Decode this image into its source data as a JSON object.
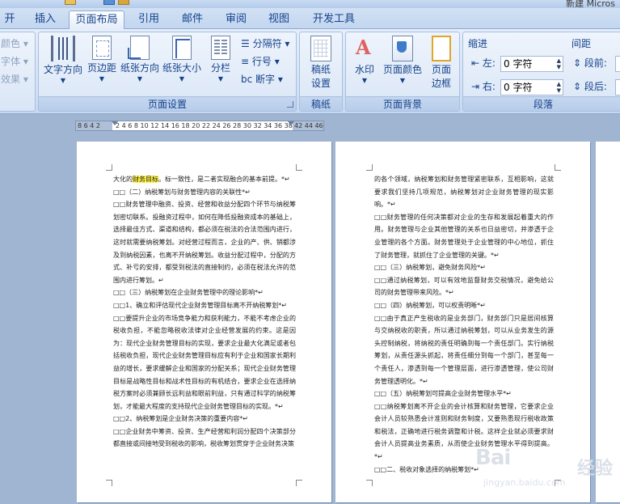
{
  "window": {
    "title_fragment": "新建 Micros"
  },
  "tabs": [
    {
      "label": "开始",
      "active": false
    },
    {
      "label": "插入",
      "active": false
    },
    {
      "label": "页面布局",
      "active": true
    },
    {
      "label": "引用",
      "active": false
    },
    {
      "label": "邮件",
      "active": false
    },
    {
      "label": "审阅",
      "active": false
    },
    {
      "label": "视图",
      "active": false
    },
    {
      "label": "开发工具",
      "active": false
    }
  ],
  "ribbon": {
    "themes": {
      "colors": "颜色",
      "fonts": "字体",
      "effects": "效果"
    },
    "page_setup": {
      "group_label": "页面设置",
      "text_direction": "文字方向",
      "margins": "页边距",
      "orientation": "纸张方向",
      "size": "纸张大小",
      "columns": "分栏",
      "breaks": "分隔符",
      "line_numbers": "行号",
      "hyphenation": "断字"
    },
    "manuscript": {
      "group_label": "稿纸",
      "settings_line1": "稿纸",
      "settings_line2": "设置"
    },
    "page_background": {
      "group_label": "页面背景",
      "watermark": "水印",
      "page_color": "页面颜色",
      "page_borders_line1": "页面",
      "page_borders_line2": "边框"
    },
    "paragraph": {
      "group_label": "段落",
      "indent_title": "缩进",
      "spacing_title": "间距",
      "indent_left_label": "左:",
      "indent_left_value": "0 字符",
      "indent_right_label": "右:",
      "indent_right_value": "0 字符",
      "spacing_before_label": "段前:",
      "spacing_after_label": "段后:"
    }
  },
  "ruler": {
    "left_numbers": "8  6  4  2",
    "numbers": "2  4  6  8 10 12 14 16 18 20 22 24 26 28 30 32 34 36 38",
    "right_numbers": "42 44 46"
  },
  "pages": [
    {
      "highlight": "财务目标",
      "paragraphs": [
        {
          "before": "大化的",
          "after": "。标一致性，是二者实现融合的基本前提。*↵"
        },
        {
          "text": "□□（二）纳税筹划与财务管理内容的关联性*↵"
        },
        {
          "text": "□□财务管理中融资、投资、经营和收益分配四个环节与纳税筹划密切联系。投融资过程中，如何在降低投融资成本的基础上，选择最佳方式、渠道和结构，都必须在税法的合法范围内进行，这时就需要纳税筹划。对经营过程而言，企业的产、供、销都涉及到纳税因素，也离不开纳税筹划。收益分配过程中，分配的方式、补亏的安排，都受到税法的直接制约，必须在税法允许的范围内进行筹划。↵"
        },
        {
          "text": "□□（三）纳税筹划在企业财务管理中的理论影响*↵"
        },
        {
          "text": "□□1、确立和评估现代企业财务管理目标离不开纳税筹划*↵"
        },
        {
          "text": "□□要提升企业的市场竞争能力和获利能力，不能不考虑企业的税收负担，不能忽略税收法律对企业经营发展的约束。这是因为：现代企业财务管理目标的实现，要求企业最大化满足或者包括税收负担，现代企业财务管理目标应有利于企业和国家长期利益的增长，要求缓解企业和国家的分配关系；现代企业财务管理目标是战略性目标和战术性目标的有机结合，要求企业在选择纳税方案时必须兼顾长远利益和眼前利益，只有通过科学的纳税筹划，才能最大程度的支持现代企业财务管理目标的实现。*↵"
        },
        {
          "text": "□□2、纳税筹划是企业财务决策的重要内容*↵"
        },
        {
          "text": "□□企业财务中筹资、投资、生产经营和利润分配四个决策部分都直接或间接地受到税收的影响，税收筹划贯穿于企业财务决策"
        }
      ]
    },
    {
      "paragraphs": [
        {
          "text": "的各个领域，纳税筹划和财务管理紧密联系，互相影响，这就要求我们坚持几项规范，纳税筹划对企业财务管理的现实影响。*↵"
        },
        {
          "text": "□□财务管理的任何决策都对企业的生存和发展起着重大的作用。财务管理与企业其他管理的关系也日益密切，并渗透于企业管理的各个方面。财务管理处于企业管理的中心地位，抓住了财务管理，就抓住了企业管理的关键。*↵"
        },
        {
          "text": "□□（三）纳税筹划，避免财务风险*↵"
        },
        {
          "text": "□□通过纳税筹划，可以有效地监督财务交税情况，避免给公司的财务管理带来风险。*↵"
        },
        {
          "text": "□□（四）纳税筹划，可以权责明晰*↵"
        },
        {
          "text": "□□由于真正产生税收的是业务部门，财务部门只是居间核算与交纳税收的职责，所以通过纳税筹划，可以从业务发生的源头控制纳税，将纳税的责任明确到每一个责任部门。实行纳税筹划，从责任源头抓起，将责任细分到每一个部门，甚至每一个责任人，渗透到每一个管理层面，进行渗透管理，使公司财务管理透明化。*↵"
        },
        {
          "text": "□□（五）纳税筹划可提高企业财务管理水平*↵"
        },
        {
          "text": "□□纳税筹划离不开企业的会计核算和财务管理，它要求企业会计人员较熟悉会计准则和财务制度，又要熟悉现行税收政策和税法，正确地进行税务调整和计税。这样企业就必须要求财会计人员提高业务素质，从而使企业财务管理水平得到提高。*↵"
        },
        {
          "text": "□□二、税收对象选择的纳税筹划*↵"
        }
      ]
    }
  ],
  "watermark": {
    "logo": "Bai",
    "logo_suffix": "经验",
    "url": "jingyan.baidu.com"
  }
}
